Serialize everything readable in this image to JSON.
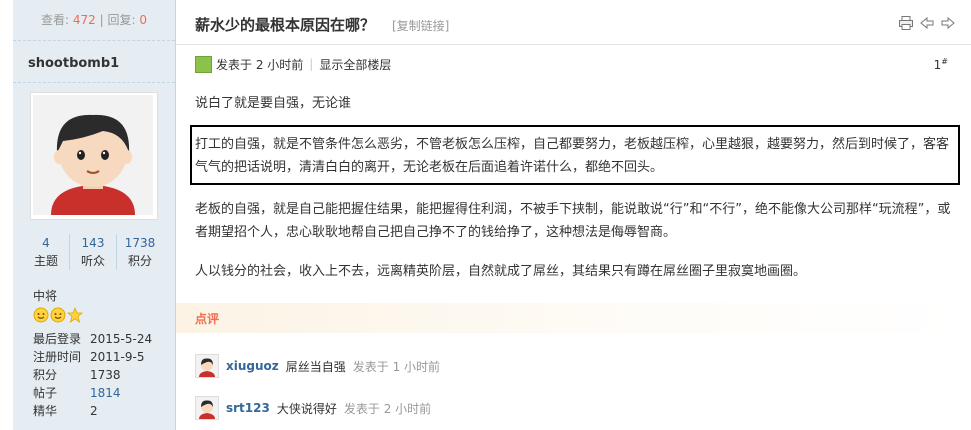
{
  "stats": {
    "views_label": "查看:",
    "views": "472",
    "divider": "|",
    "replies_label": "回复:",
    "replies": "0"
  },
  "user": {
    "name": "shootbomb1",
    "counts": [
      {
        "value": "4",
        "label": "主题"
      },
      {
        "value": "143",
        "label": "听众"
      },
      {
        "value": "1738",
        "label": "积分"
      }
    ],
    "rank": "中将",
    "profile": [
      {
        "key": "最后登录",
        "value": "2015-5-24"
      },
      {
        "key": "注册时间",
        "value": "2011-9-5"
      },
      {
        "key": "积分",
        "value": "1738"
      },
      {
        "key": "帖子",
        "value": "1814"
      },
      {
        "key": "精华",
        "value": "2"
      }
    ]
  },
  "thread": {
    "title": "薪水少的最根本原因在哪？",
    "copy_link": "[复制链接]",
    "posted": "发表于 2 小时前",
    "separator": "|",
    "show_all": "显示全部楼层",
    "floor": "1",
    "floor_sup": "#"
  },
  "post": {
    "p1": "说白了就是要自强，无论谁",
    "p2": "打工的自强，就是不管条件怎么恶劣，不管老板怎么压榨，自己都要努力，老板越压榨，心里越狠，越要努力，然后到时候了，客客气气的把话说明，清清白白的离开，无论老板在后面追着许诺什么，都绝不回头。",
    "p3": "老板的自强，就是自己能把握住结果，能把握得住利润，不被手下挟制，能说敢说“行”和“不行”，绝不能像大公司那样“玩流程”，或者期望招个人，忠心耿耿地帮自己把自己挣不了的钱给挣了，这种想法是侮辱智商。",
    "p4": "人以钱分的社会，收入上不去，远离精英阶层，自然就成了屌丝，其结果只有蹲在屌丝圈子里寂寞地画圈。"
  },
  "comments": {
    "label": "点评",
    "items": [
      {
        "user": "xiuguoz",
        "text": "屌丝当自强",
        "time": "发表于 1 小时前"
      },
      {
        "user": "srt123",
        "text": "大侠说得好",
        "time": "发表于 2 小时前"
      }
    ]
  },
  "colors": {
    "accent": "#f26c4f",
    "link": "#336699",
    "sidebar_bg": "#e5edf2"
  },
  "icons": [
    "printer-icon",
    "previous-thread-icon",
    "next-thread-icon",
    "online-status-icon",
    "medal-icon",
    "star-icon"
  ]
}
